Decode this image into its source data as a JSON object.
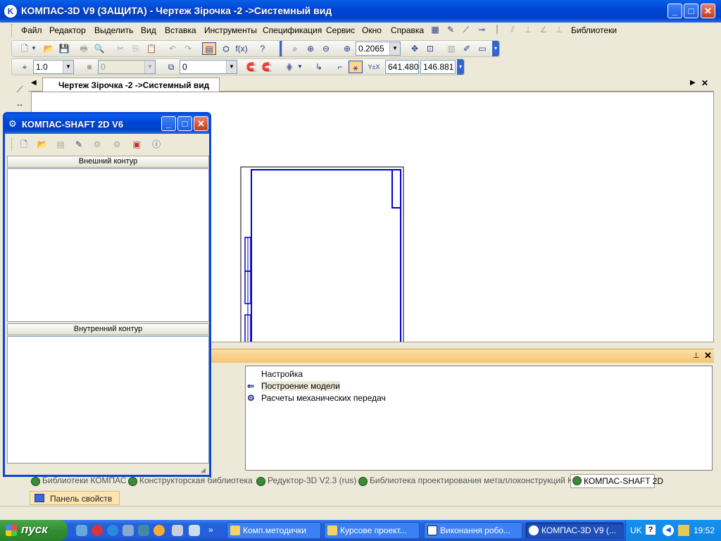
{
  "window": {
    "title": "КОМПАС-3D V9 (ЗАЩИТА) - Чертеж Зірочка -2 ->Системный вид",
    "app_icon": "kompas-logo-icon",
    "minimize_icon": "minimize-icon",
    "maximize_icon": "maximize-icon",
    "close_icon": "close-icon"
  },
  "menu": {
    "items": [
      "Файл",
      "Редактор",
      "Выделить",
      "Вид",
      "Вставка",
      "Инструменты",
      "Спецификация",
      "Сервис",
      "Окно",
      "Справка"
    ],
    "libraries_label": "Библиотеки"
  },
  "toolbar_standard": {
    "zoom_value": "0.2065"
  },
  "toolbar_current": {
    "step_value": "1.0",
    "style_value": "0",
    "layer_value": "0",
    "coord_x": "641.480",
    "coord_y": "146.881"
  },
  "doc_tab": {
    "label": "Чертеж Зірочка -2 ->Системный вид"
  },
  "shaft_window": {
    "title": "КОМПАС-SHAFT 2D V6",
    "outer_contour": "Внешний контур",
    "inner_contour": "Внутренний контур"
  },
  "library_panel": {
    "items": [
      {
        "label": "Настройка",
        "icon": ""
      },
      {
        "label": "Построение модели",
        "icon": "arrow-left-icon"
      },
      {
        "label": "Расчеты механических передач",
        "icon": "gear-tool-icon"
      }
    ],
    "tabs": [
      "Библиотеки КОМПАС",
      "Конструкторская библиотека",
      "Редуктор-3D V2.3 (rus)",
      "Библиотека проектирования металлоконструкций КМ",
      "КОМПАС-SHAFT 2D"
    ],
    "active_tab": 4
  },
  "properties_panel": {
    "label": "Панель свойств"
  },
  "taskbar": {
    "start_label": "пуск",
    "tasks": [
      {
        "label": "Комп.методички",
        "icon": "folder-icon"
      },
      {
        "label": "Курсове проект...",
        "icon": "folder-icon"
      },
      {
        "label": "Виконання робо...",
        "icon": "word-doc-icon"
      },
      {
        "label": "КОМПАС-3D V9 (...",
        "icon": "kompas-logo-icon"
      }
    ],
    "language": "UK",
    "clock": "19:52"
  },
  "colors": {
    "xp_blue": "#0046d5",
    "drawing_line": "#0000c8",
    "library_header": "#f6c571"
  }
}
